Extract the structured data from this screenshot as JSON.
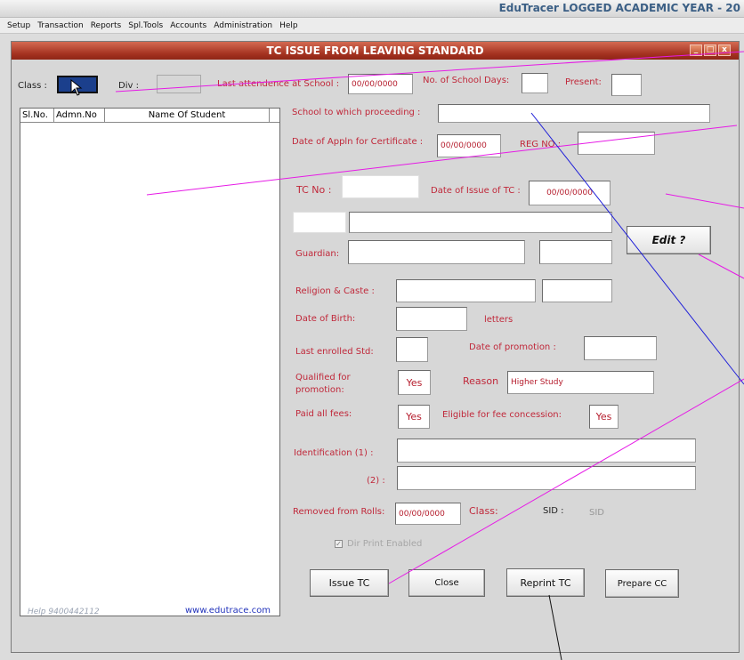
{
  "app": {
    "title": "EduTracer  LOGGED ACADEMIC YEAR  - 20"
  },
  "menu": [
    "Setup",
    "Transaction",
    "Reports",
    "Spl.Tools",
    "Accounts",
    "Administration",
    "Help"
  ],
  "window": {
    "title": "TC ISSUE FROM LEAVING STANDARD",
    "min": "_",
    "max": "□",
    "close": "x"
  },
  "filters": {
    "class_label": "Class :",
    "div_label": "Div :",
    "class_value": "",
    "div_value": ""
  },
  "list": {
    "columns": [
      "Sl.No.",
      "Admn.No",
      "Name Of Student"
    ],
    "rows": []
  },
  "form": {
    "last_attendance_label": "Last attendence at School :",
    "last_attendance_value": "00/00/0000",
    "school_days_label": "No. of School Days:",
    "school_days_value": "",
    "present_label": "Present:",
    "present_value": "",
    "school_proceeding_label": "School to which proceeding :",
    "school_proceeding_value": "",
    "appln_date_label": "Date of Appln for Certificate :",
    "appln_date_value": "00/00/0000",
    "reg_no_label": "REG NO :",
    "reg_no_value": "",
    "tc_no_label": "TC No :",
    "tc_no_value": "",
    "tc_issue_date_label": "Date of Issue of TC :",
    "tc_issue_date_value": "00/00/0000",
    "name_prefix_value": "",
    "name_value": "",
    "edit_label": "Edit ?",
    "guardian_label": "Guardian:",
    "guardian_value": "",
    "guardian_extra_value": "",
    "religion_label": "Religion & Caste :",
    "religion_value": "",
    "caste_value": "",
    "dob_label": "Date of Birth:",
    "dob_value": "",
    "letters_label": "letters",
    "last_std_label": "Last enrolled Std:",
    "last_std_value": "",
    "promotion_date_label": "Date of promotion :",
    "promotion_date_value": "",
    "qualified_label_1": "Qualified for",
    "qualified_label_2": "promotion:",
    "qualified_value": "Yes",
    "reason_label": "Reason",
    "reason_value": "Higher Study",
    "paid_fees_label": "Paid all fees:",
    "paid_fees_value": "Yes",
    "concession_label": "Eligible for fee concession:",
    "concession_value": "Yes",
    "identification_label": "Identification  (1) :",
    "identification2_label": "(2) :",
    "identification1_value": "",
    "identification2_value": "",
    "removed_label": "Removed from Rolls:",
    "removed_value": "00/00/0000",
    "class_label": "Class:",
    "sid_label": "SID :",
    "sid_value": "SID",
    "dir_print_label": "Dir Print Enabled"
  },
  "buttons": {
    "issue": "Issue TC",
    "close": "Close",
    "reprint": "Reprint TC",
    "prepare": "Prepare CC"
  },
  "footer": {
    "help": "Help  9400442112",
    "website": "www.edutrace.com"
  }
}
